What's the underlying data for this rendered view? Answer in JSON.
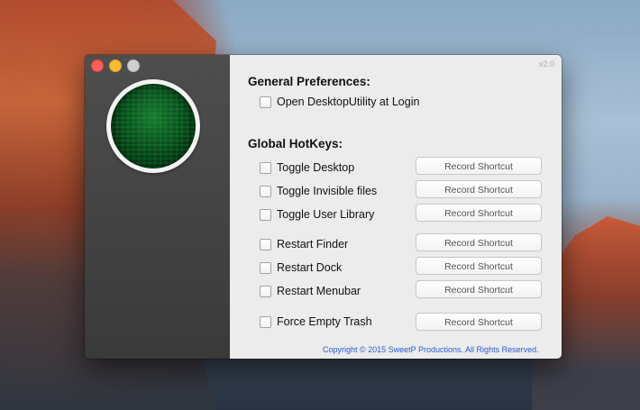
{
  "window": {
    "version": "v2.0"
  },
  "general": {
    "heading": "General Preferences:",
    "login_label": "Open DesktopUtility at Login"
  },
  "hotkeys": {
    "heading": "Global HotKeys:",
    "button_label": "Record Shortcut",
    "items": [
      {
        "label": "Toggle Desktop",
        "button": "Record Shortcut"
      },
      {
        "label": "Toggle Invisible files",
        "button": "Record Shortcut"
      },
      {
        "label": "Toggle User Library",
        "button": "Record Shortcut"
      },
      {
        "label": "Restart Finder",
        "button": "Record Shortcut"
      },
      {
        "label": "Restart Dock",
        "button": "Record Shortcut"
      },
      {
        "label": "Restart Menubar",
        "button": "Record Shortcut"
      },
      {
        "label": "Force Empty Trash",
        "button": "Record Shortcut"
      }
    ]
  },
  "footer": {
    "copyright": "Copyright © 2015 SweetP Productions. All Rights Reserved."
  },
  "colors": {
    "sidebar": "#3f3f3f",
    "content_bg": "#ececec",
    "link_blue": "#2a5bd7"
  }
}
